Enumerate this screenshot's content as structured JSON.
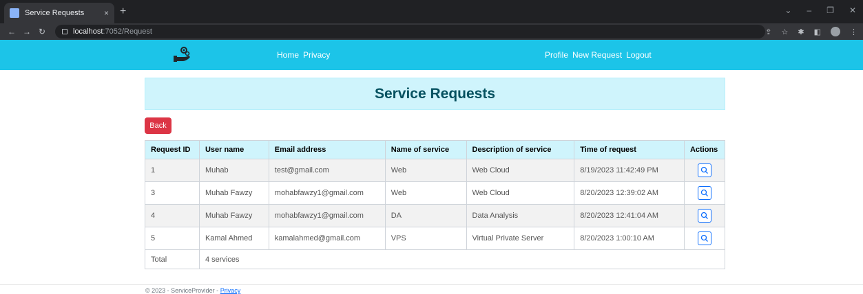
{
  "browser": {
    "tab_title": "Service Requests",
    "tab_close": "×",
    "new_tab": "+",
    "url_host": "localhost",
    "url_path": ":7052/Request"
  },
  "navbar": {
    "home": "Home",
    "privacy": "Privacy",
    "profile": "Profile",
    "new_request": "New Request",
    "logout": "Logout"
  },
  "page": {
    "title": "Service Requests",
    "back_label": "Back"
  },
  "table": {
    "headers": [
      "Request ID",
      "User name",
      "Email address",
      "Name of service",
      "Description of service",
      "Time of request",
      "Actions"
    ],
    "rows": [
      {
        "id": "1",
        "user": "Muhab",
        "email": "test@gmail.com",
        "service": "Web",
        "description": "Web Cloud",
        "time": "8/19/2023 11:42:49 PM"
      },
      {
        "id": "3",
        "user": "Muhab Fawzy",
        "email": "mohabfawzy1@gmail.com",
        "service": "Web",
        "description": "Web Cloud",
        "time": "8/20/2023 12:39:02 AM"
      },
      {
        "id": "4",
        "user": "Muhab Fawzy",
        "email": "mohabfawzy1@gmail.com",
        "service": "DA",
        "description": "Data Analysis",
        "time": "8/20/2023 12:41:04 AM"
      },
      {
        "id": "5",
        "user": "Kamal Ahmed",
        "email": "kamalahmed@gmail.com",
        "service": "VPS",
        "description": "Virtual Private Server",
        "time": "8/20/2023 1:00:10 AM"
      }
    ],
    "total_label": "Total",
    "total_value": "4 services"
  },
  "footer": {
    "copyright": "© 2023 - ServiceProvider - ",
    "privacy": "Privacy"
  },
  "colors": {
    "navbar": "#1cc4e8",
    "heading_bg": "#cff4fc",
    "back_button": "#dc3545",
    "view_button_border": "#0d6efd"
  }
}
